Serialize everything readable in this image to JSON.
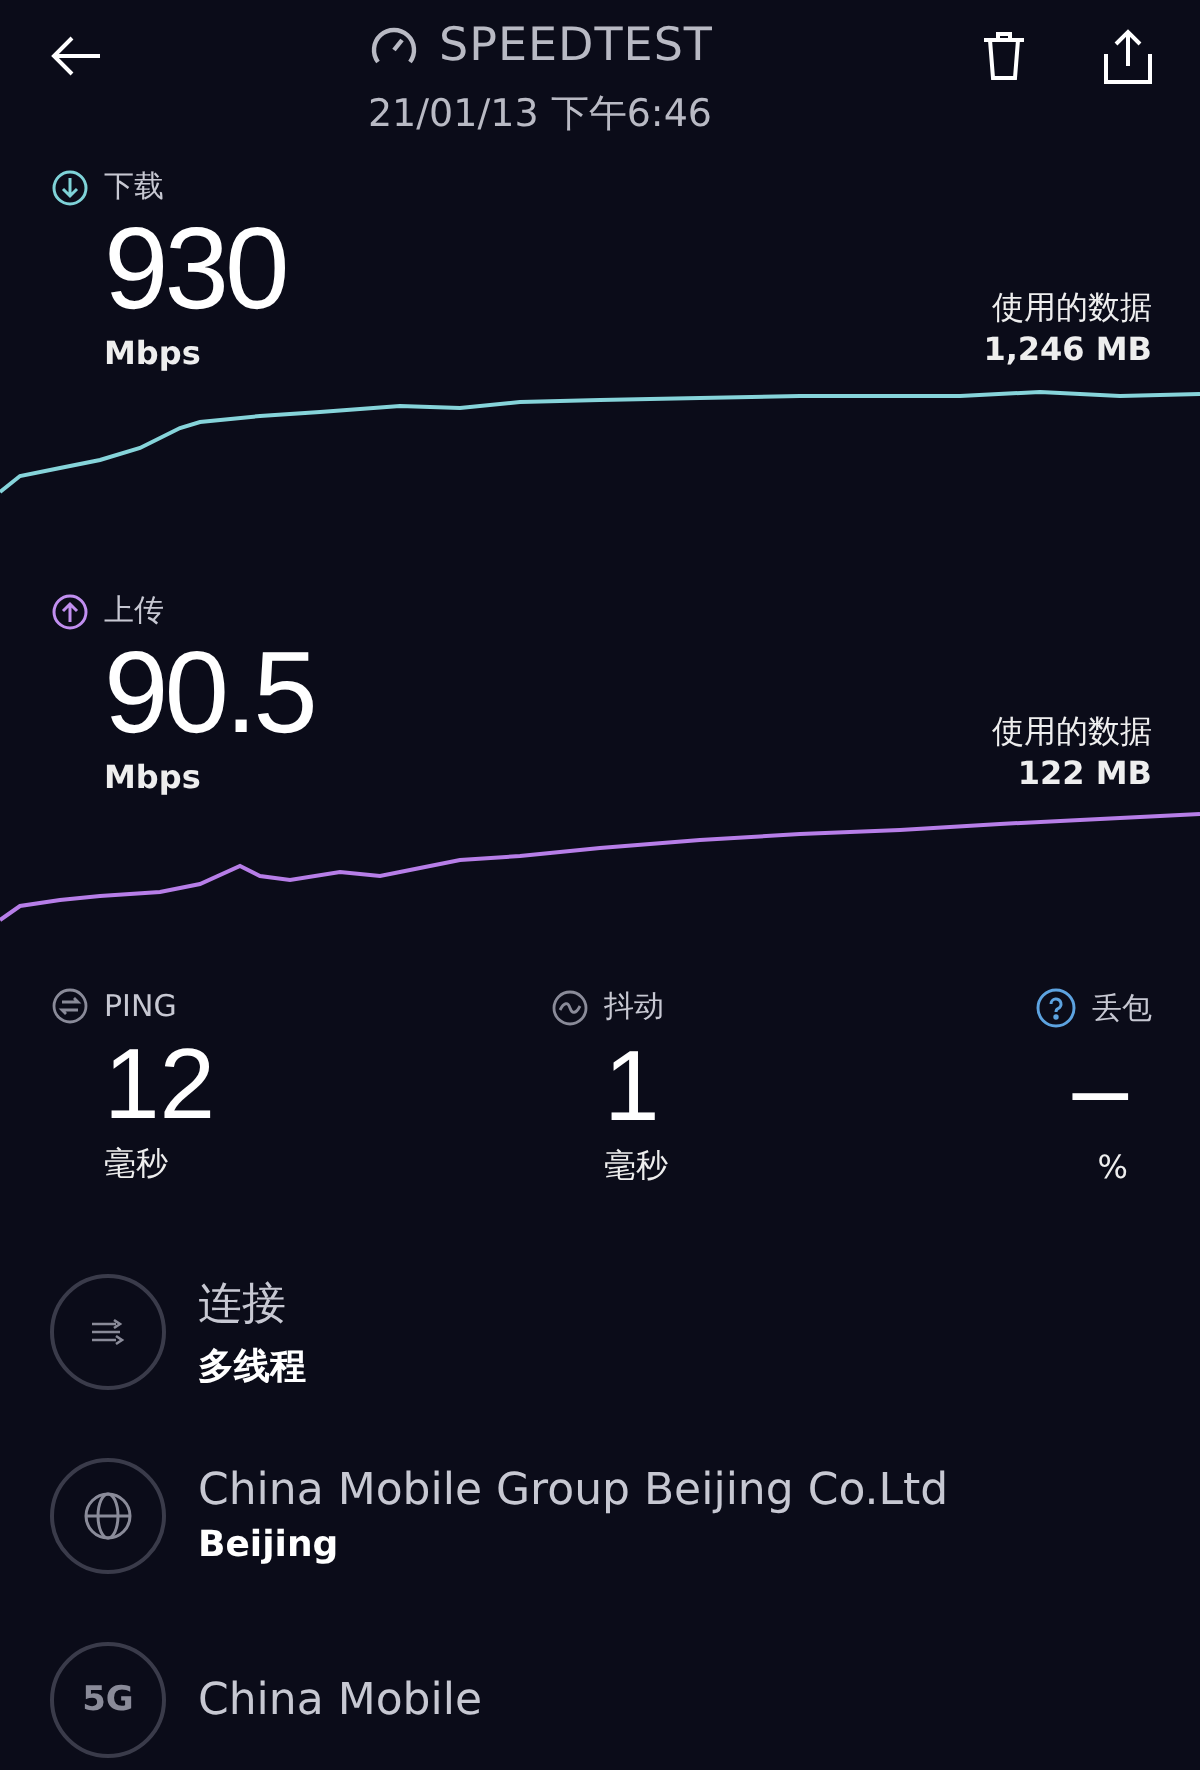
{
  "header": {
    "title": "SPEEDTEST",
    "date": "21/01/13 下午6:46"
  },
  "results": [
    {
      "kind": "download",
      "label": "下载",
      "value": "930",
      "unit": "Mbps",
      "data_label": "使用的数据",
      "data_value": "1,246 MB"
    },
    {
      "kind": "upload",
      "label": "上传",
      "value": "90.5",
      "unit": "Mbps",
      "data_label": "使用的数据",
      "data_value": "122 MB"
    }
  ],
  "stats": [
    {
      "kind": "ping",
      "label": "PING",
      "value": "12",
      "unit": "毫秒"
    },
    {
      "kind": "jitter",
      "label": "抖动",
      "value": "1",
      "unit": "毫秒"
    },
    {
      "kind": "loss",
      "label": "丢包",
      "value": "–",
      "unit": "%"
    }
  ],
  "details": [
    {
      "kind": "connection",
      "title": "连接",
      "subtitle": "多线程"
    },
    {
      "kind": "server",
      "title": "China Mobile Group Beijing Co.Ltd",
      "subtitle": "Beijing"
    },
    {
      "kind": "network",
      "badge": "5G",
      "title": "China Mobile"
    }
  ]
}
